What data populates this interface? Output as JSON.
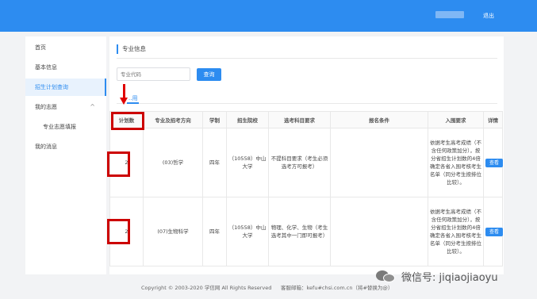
{
  "topbar": {
    "logout": "退出"
  },
  "sidebar": {
    "items": [
      {
        "label": "首页"
      },
      {
        "label": "基本信息"
      },
      {
        "label": "招生计划查询"
      },
      {
        "label": "我的志愿"
      },
      {
        "label": "专业志愿填报"
      },
      {
        "label": "我的消息"
      }
    ],
    "chevron": "^"
  },
  "main": {
    "section_title": "专业信息",
    "search_placeholder": "专业代码",
    "search_button": "查询",
    "tab_label": "..用"
  },
  "table": {
    "headers": [
      "计划数",
      "专业及招考方向",
      "学制",
      "招生院校",
      "选考科目要求",
      "报名条件",
      "入围要求",
      "详情"
    ],
    "rows": [
      {
        "plan": "2",
        "major": "(03)哲学",
        "years": "四年",
        "school": "（10558）中山大学",
        "subjects": "不提科目要求（考生必须选考方可报考）",
        "condition": "",
        "admission": "依据考生高考成绩（不含任何政策加分），按分省招生计划数的4倍确定各省入围考核考生名单（同分考生按排位比较）。",
        "detail": "查看"
      },
      {
        "plan": "2",
        "major": "(07)生物科学",
        "years": "四年",
        "school": "（10558）中山大学",
        "subjects": "物理、化学、生物（考生选考其中一门即可报考）",
        "condition": "",
        "admission": "依据考生高考成绩（不含任何政策加分），按分省招生计划数的4倍确定各省入围考核考生名单（同分考生按排位比较）。",
        "detail": "查看"
      }
    ]
  },
  "footer": {
    "copyright": "Copyright © 2003-2020 学信网 All Rights Reserved",
    "email": "客服邮箱：kefu#chsi.com.cn（将#替换为@）"
  },
  "watermark": "微信号: jiqiaojiaoyu",
  "colors": {
    "accent": "#2d8cf0",
    "annotation": "#cc0000"
  }
}
